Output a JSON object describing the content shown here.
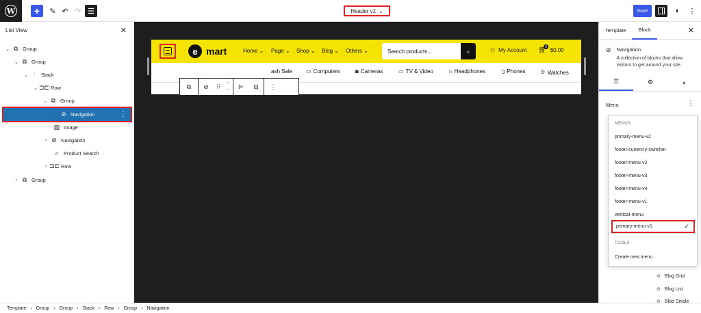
{
  "topbar": {
    "add_icon": "plus-icon",
    "doc_title": "Header v1",
    "save_label": "Save"
  },
  "list_view": {
    "title": "List View",
    "rows": [
      {
        "label": "Group",
        "icon": "group-icon"
      },
      {
        "label": "Group",
        "icon": "group-icon"
      },
      {
        "label": "Stack",
        "icon": "stack-icon"
      },
      {
        "label": "Row",
        "icon": "row-icon"
      },
      {
        "label": "Group",
        "icon": "group-icon"
      },
      {
        "label": "Navigation",
        "icon": "navigation-icon"
      },
      {
        "label": "Image",
        "icon": "image-icon"
      },
      {
        "label": "Navigation",
        "icon": "navigation-icon"
      },
      {
        "label": "Product Search",
        "icon": "search-icon"
      },
      {
        "label": "Row",
        "icon": "row-icon"
      },
      {
        "label": "Group",
        "icon": "group-icon"
      }
    ]
  },
  "canvas": {
    "logo_letter": "e",
    "logo_text": "mart",
    "nav": [
      "Home",
      "Page",
      "Shop",
      "Blog",
      "Others"
    ],
    "search_placeholder": "Search products...",
    "account": "My Account",
    "cart_count": "0",
    "cart_total": "$0.00",
    "categories": [
      "ash Sale",
      "Computers",
      "Cameras",
      "TV & Video",
      "Headphones",
      "Phones",
      "Watches"
    ]
  },
  "inspector": {
    "tab_template": "Template",
    "tab_block": "Block",
    "block_title": "Navigation",
    "block_desc": "A collection of blocks that allow visitors to get around your site.",
    "menu_label": "Menu",
    "menus_heading": "MENUS",
    "menus": [
      "primary-menu-v2",
      "footer-currency-switcher",
      "footer-menu-v2",
      "footer-menu-v3",
      "footer-menu-v4",
      "footer-menu-v1",
      "vertical-menu",
      "primary-menu-v1"
    ],
    "tools_heading": "TOOLS",
    "create_menu": "Create new menu",
    "behind_items": [
      "Blog Grid",
      "Blog List",
      "Blog Single"
    ]
  },
  "breadcrumb": [
    "Template",
    "Group",
    "Group",
    "Stack",
    "Row",
    "Group",
    "Navigation"
  ],
  "colors": {
    "accent": "#3858e9",
    "selection": "#2271b1",
    "header_yellow": "#f5e301",
    "highlight": "#e02020"
  }
}
